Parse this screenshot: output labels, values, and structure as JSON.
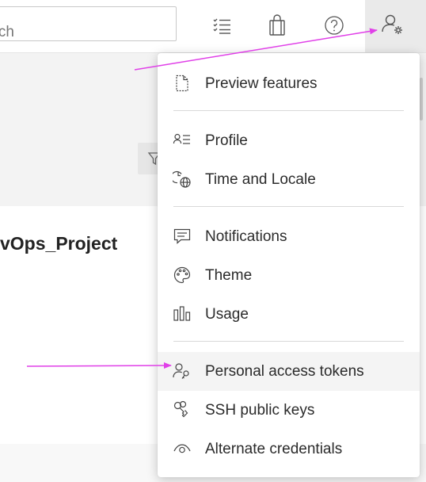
{
  "header": {
    "search_text": "arch"
  },
  "project": {
    "title": "vOps_Project"
  },
  "menu": {
    "items": [
      {
        "label": "Preview features",
        "icon": "page-icon"
      },
      {
        "label": "Profile",
        "icon": "profile-card-icon"
      },
      {
        "label": "Time and Locale",
        "icon": "clock-globe-icon"
      },
      {
        "label": "Notifications",
        "icon": "comment-icon"
      },
      {
        "label": "Theme",
        "icon": "palette-icon"
      },
      {
        "label": "Usage",
        "icon": "bar-chart-icon"
      },
      {
        "label": "Personal access tokens",
        "icon": "user-key-icon"
      },
      {
        "label": "SSH public keys",
        "icon": "keys-icon"
      },
      {
        "label": "Alternate credentials",
        "icon": "eye-icon"
      }
    ]
  },
  "colors": {
    "annotation_arrow": "#e040e8",
    "menu_hover": "#f4f4f4"
  }
}
